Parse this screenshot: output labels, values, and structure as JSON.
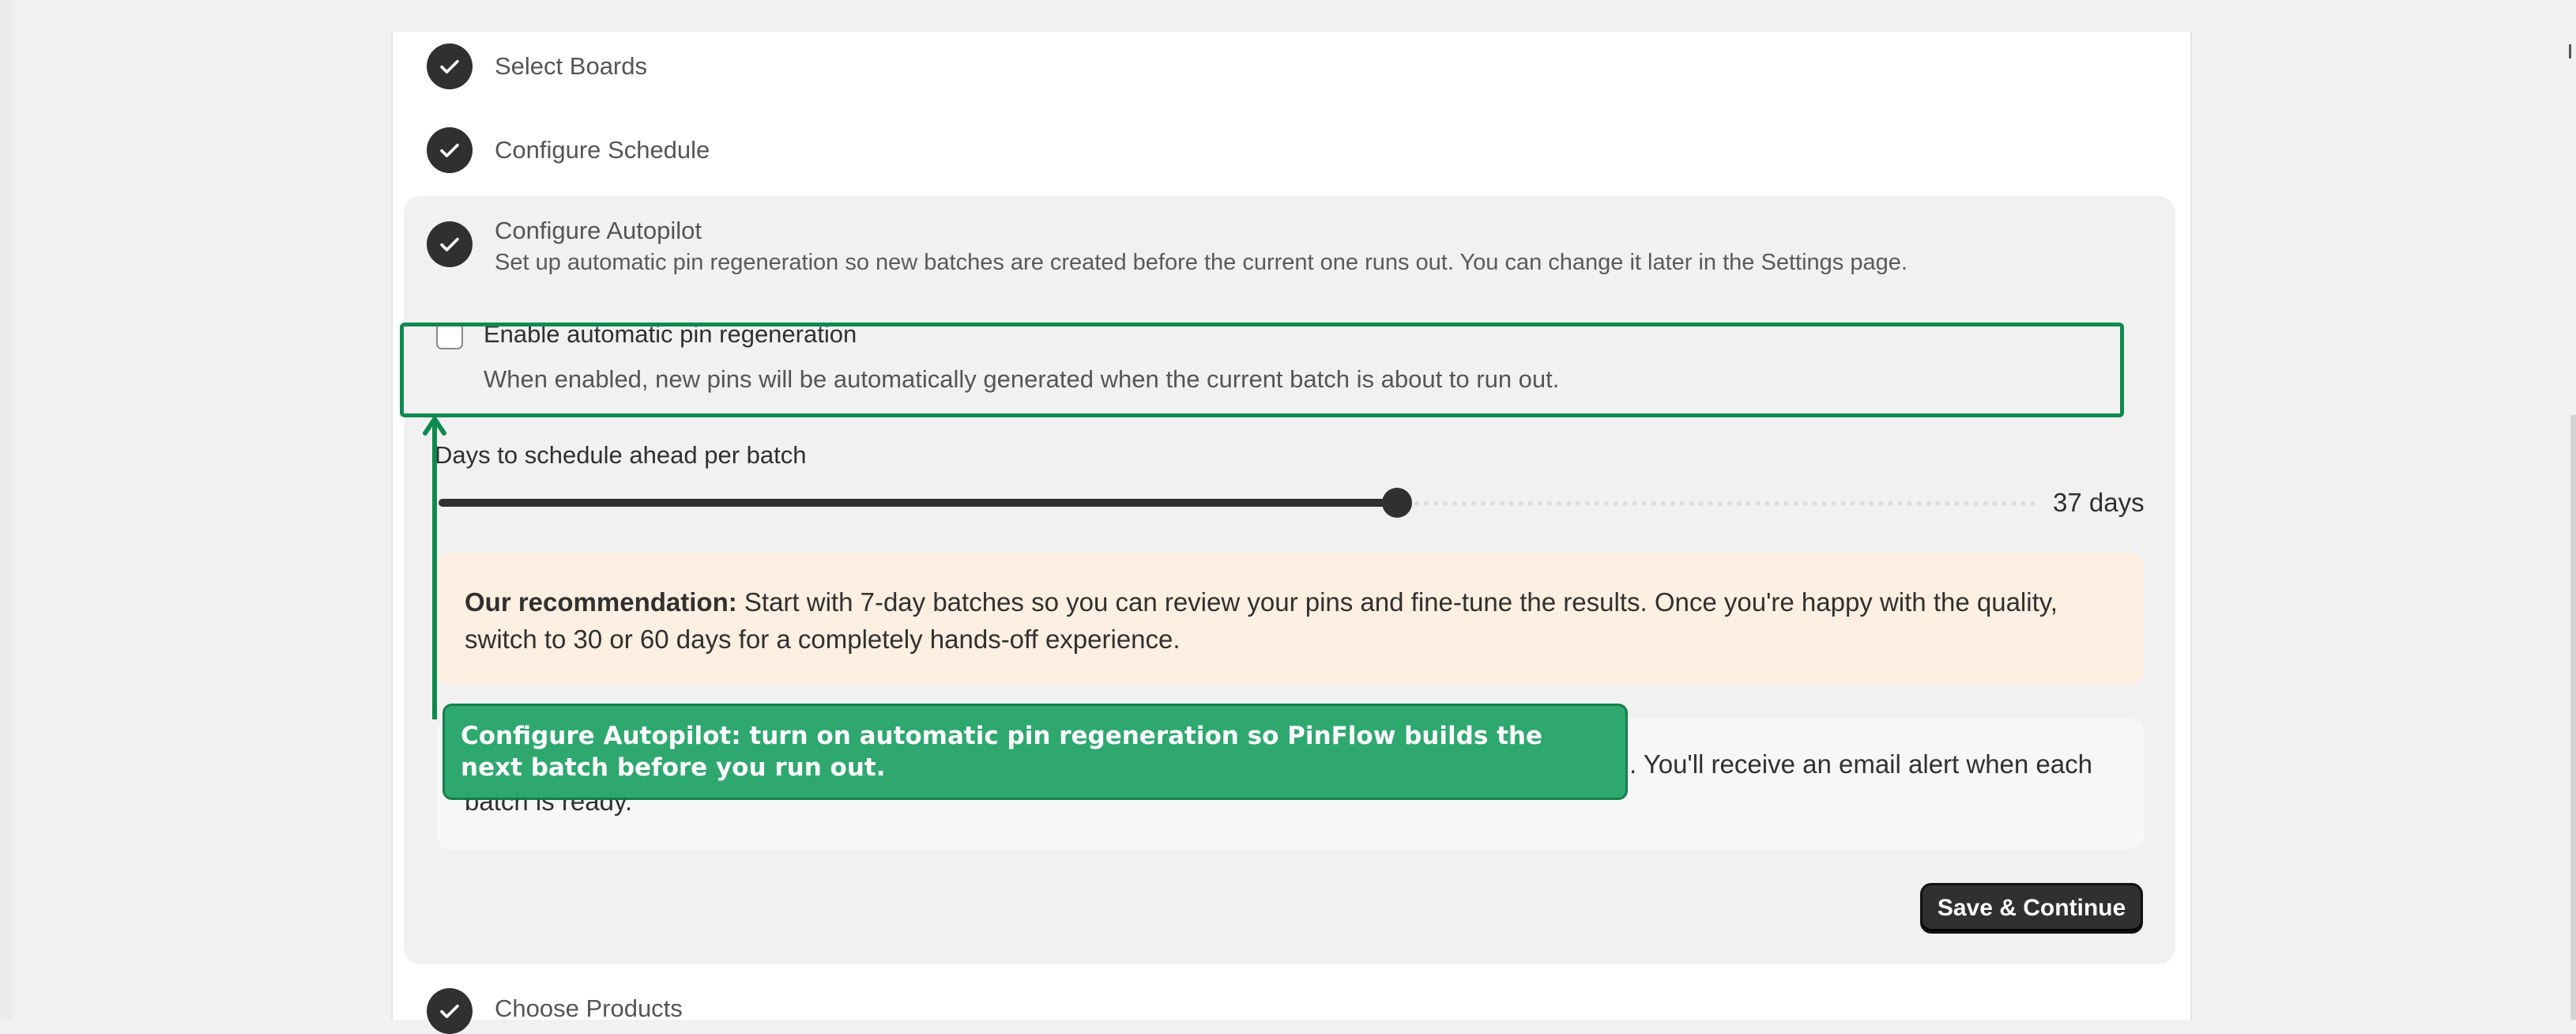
{
  "steps": {
    "select_boards": "Select Boards",
    "configure_schedule": "Configure Schedule",
    "configure_autopilot": "Configure Autopilot",
    "choose_products": "Choose Products"
  },
  "autopilot": {
    "description": "Set up automatic pin regeneration so new batches are created before the current one runs out. You can change it later in the Settings page.",
    "checkbox_label": "Enable automatic pin regeneration",
    "checkbox_checked": false,
    "checkbox_help": "When enabled, new pins will be automatically generated when the current batch is about to run out.",
    "slider_label": "Days to schedule ahead per batch",
    "slider_value_text": "37 days",
    "slider_fraction": 0.6,
    "recommendation_bold": "Our recommendation:",
    "recommendation_text": " Start with 7-day batches so you can review your pins and fine-tune the results. Once you're happy with the quality, switch to 30 or 60 days for a completely hands-off experience.",
    "summary_line1_visible": ". You'll receive an email alert when each",
    "summary_line2": "batch is ready.",
    "save_label": "Save & Continue"
  },
  "tooltip": {
    "text": "Configure Autopilot: turn on automatic pin regeneration so PinFlow builds the next batch before you run out."
  },
  "colors": {
    "highlight": "#0f8a4f",
    "tooltip_bg": "#28a66b",
    "recommendation_bg": "#fdefe1",
    "primary_dark": "#303030"
  }
}
